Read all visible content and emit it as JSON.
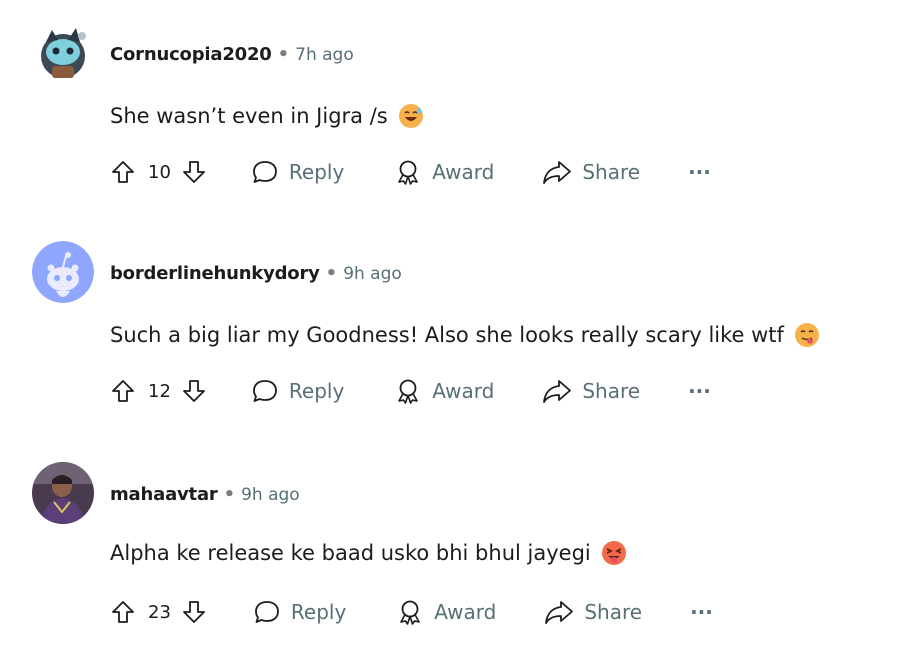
{
  "comments": [
    {
      "username": "Cornucopia2020",
      "separator": "•",
      "time": "7h ago",
      "text": "She wasn’t even in Jigra /s",
      "emoji": "grinning-sweat-emoji",
      "votes": "10",
      "reply_label": "Reply",
      "award_label": "Award",
      "share_label": "Share",
      "more_label": "···",
      "avatar": "snoo-avatar-custom"
    },
    {
      "username": "borderlinehunkydory",
      "separator": "•",
      "time": "9h ago",
      "text": "Such a big liar my Goodness! Also she looks really scary like wtf",
      "emoji": "face-savoring-emoji",
      "votes": "12",
      "reply_label": "Reply",
      "award_label": "Award",
      "share_label": "Share",
      "more_label": "···",
      "avatar": "snoo-default-avatar"
    },
    {
      "username": "mahaavtar",
      "separator": "•",
      "time": "9h ago",
      "text": "Alpha ke release ke baad usko bhi bhul jayegi",
      "emoji": "tongue-out-emoji",
      "votes": "23",
      "reply_label": "Reply",
      "award_label": "Award",
      "share_label": "Share",
      "more_label": "···",
      "avatar": "photo-avatar"
    }
  ],
  "colors": {
    "text": "#1c1c1c",
    "muted": "#576f76",
    "snoo_bg": "#8fa6ff"
  }
}
